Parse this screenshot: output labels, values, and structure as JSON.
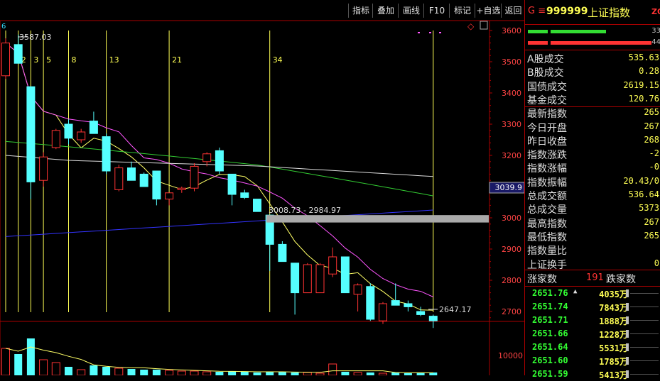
{
  "toolbar": {
    "buttons": [
      "指标",
      "叠加",
      "画线",
      "F10",
      "标记",
      "+自选",
      "返回"
    ]
  },
  "colors": {
    "up": "#ff3333",
    "down": "#55ffff",
    "ma_white": "#dddddd",
    "ma_yellow": "#ffff66",
    "ma_magenta": "#ff55ff",
    "ma_green": "#33cc33",
    "ma_blue": "#3333ff",
    "vline": "#ffff55",
    "axis": "#aa0000"
  },
  "chart": {
    "price_labels": [
      "3600",
      "3500",
      "3400",
      "3300",
      "3200",
      "3100",
      "3000",
      "2900",
      "2800",
      "2700"
    ],
    "current_price_label": "3039.9",
    "volume_label": "10000",
    "high_label": "3587.03",
    "low_label": "2647.17",
    "range_label": "3008.73 - 2984.97",
    "fib_labels": [
      "2",
      "3",
      "5",
      "8",
      "13",
      "21",
      "34"
    ],
    "top_marker": "6"
  },
  "chart_data": {
    "type": "candlestick",
    "ylim": [
      2610,
      3630
    ],
    "candles": [
      {
        "o": 3455,
        "h": 3575,
        "l": 3445,
        "c": 3560
      },
      {
        "o": 3555,
        "h": 3587.03,
        "l": 3500,
        "c": 3495
      },
      {
        "o": 3420,
        "h": 3420,
        "l": 3060,
        "c": 3115
      },
      {
        "o": 3120,
        "h": 3210,
        "l": 3100,
        "c": 3195
      },
      {
        "o": 3225,
        "h": 3285,
        "l": 3220,
        "c": 3280
      },
      {
        "o": 3300,
        "h": 3315,
        "l": 3235,
        "c": 3255
      },
      {
        "o": 3250,
        "h": 3285,
        "l": 3240,
        "c": 3275
      },
      {
        "o": 3310,
        "h": 3340,
        "l": 3270,
        "c": 3270
      },
      {
        "o": 3260,
        "h": 3270,
        "l": 3140,
        "c": 3150
      },
      {
        "o": 3090,
        "h": 3170,
        "l": 3085,
        "c": 3160
      },
      {
        "o": 3160,
        "h": 3180,
        "l": 3120,
        "c": 3120
      },
      {
        "o": 3140,
        "h": 3145,
        "l": 3100,
        "c": 3100
      },
      {
        "o": 3150,
        "h": 3150,
        "l": 3040,
        "c": 3060
      },
      {
        "o": 3060,
        "h": 3080,
        "l": 3040,
        "c": 3080
      },
      {
        "o": 3090,
        "h": 3100,
        "l": 3080,
        "c": 3095
      },
      {
        "o": 3095,
        "h": 3175,
        "l": 3085,
        "c": 3165
      },
      {
        "o": 3180,
        "h": 3210,
        "l": 3165,
        "c": 3205
      },
      {
        "o": 3215,
        "h": 3225,
        "l": 3140,
        "c": 3150
      },
      {
        "o": 3140,
        "h": 3140,
        "l": 3040,
        "c": 3075
      },
      {
        "o": 3080,
        "h": 3090,
        "l": 3060,
        "c": 3065
      },
      {
        "o": 3060,
        "h": 3060,
        "l": 3020,
        "c": 3020
      },
      {
        "o": 3008.73,
        "h": 3010,
        "l": 2830,
        "c": 2915
      },
      {
        "o": 2915,
        "h": 2925,
        "l": 2860,
        "c": 2860
      },
      {
        "o": 2855,
        "h": 2855,
        "l": 2690,
        "c": 2760
      },
      {
        "o": 2760,
        "h": 2855,
        "l": 2760,
        "c": 2850
      },
      {
        "o": 2760,
        "h": 2855,
        "l": 2760,
        "c": 2850
      },
      {
        "o": 2820,
        "h": 2905,
        "l": 2810,
        "c": 2875
      },
      {
        "o": 2875,
        "h": 2875,
        "l": 2760,
        "c": 2760
      },
      {
        "o": 2755,
        "h": 2790,
        "l": 2700,
        "c": 2785
      },
      {
        "o": 2780,
        "h": 2790,
        "l": 2670,
        "c": 2675
      },
      {
        "o": 2670,
        "h": 2730,
        "l": 2660,
        "c": 2725
      },
      {
        "o": 2735,
        "h": 2790,
        "l": 2720,
        "c": 2720
      },
      {
        "o": 2725,
        "h": 2735,
        "l": 2700,
        "c": 2715
      },
      {
        "o": 2700,
        "h": 2715,
        "l": 2685,
        "c": 2690
      },
      {
        "o": 2685,
        "h": 2690,
        "l": 2647.17,
        "c": 2670
      }
    ]
  },
  "sidebar": {
    "code_prefix": "G ≡",
    "code": "999999",
    "name": "上证指数",
    "badge": "ZQ",
    "bar1_count": "33",
    "bar2_count": "44",
    "stats": [
      {
        "label": "A股成交",
        "value": "535.63"
      },
      {
        "label": "B股成交",
        "value": "0.28"
      },
      {
        "label": "国债成交",
        "value": "2619.15"
      },
      {
        "label": "基金成交",
        "value": "120.76"
      },
      {
        "label": "最新指数",
        "value": "265"
      },
      {
        "label": "今日开盘",
        "value": "267"
      },
      {
        "label": "昨日收盘",
        "value": "268"
      },
      {
        "label": "指数涨跌",
        "value": "-2"
      },
      {
        "label": "指数涨幅",
        "value": "-0"
      },
      {
        "label": "指数振幅",
        "value": "20.43/0"
      },
      {
        "label": "总成交额",
        "value": "536.64"
      },
      {
        "label": "总成交量",
        "value": "5373"
      },
      {
        "label": "最高指数",
        "value": "267"
      },
      {
        "label": "最低指数",
        "value": "265"
      },
      {
        "label": "指数量比",
        "value": ""
      },
      {
        "label": "上证换手",
        "value": "0"
      }
    ],
    "rise_label": "涨家数",
    "rise_count": "191",
    "fall_label": "跌家数",
    "ticks": [
      {
        "price": "2651.76",
        "arrow": "▲",
        "vol": "4035万"
      },
      {
        "price": "2651.74",
        "arrow": "",
        "vol": "7843万"
      },
      {
        "price": "2651.71",
        "arrow": "",
        "vol": "1888万"
      },
      {
        "price": "2651.66",
        "arrow": "",
        "vol": "1228万"
      },
      {
        "price": "2651.64",
        "arrow": "",
        "vol": "5531万"
      },
      {
        "price": "2651.60",
        "arrow": "",
        "vol": "1785万"
      },
      {
        "price": "2651.59",
        "arrow": "",
        "vol": "5413万"
      }
    ]
  }
}
